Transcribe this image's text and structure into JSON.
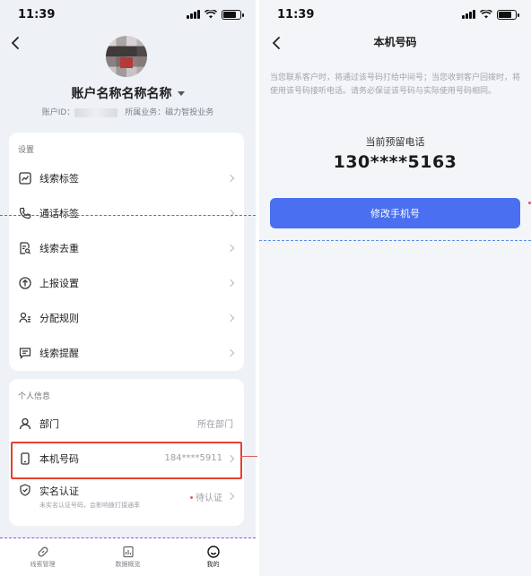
{
  "left": {
    "status": {
      "time": "11:39"
    },
    "account": {
      "name": "账户名称名称名称",
      "id_label": "账户ID：",
      "business_label": "所属业务：",
      "business_value": "磁力智投业务"
    },
    "settings": {
      "title": "设置",
      "items": [
        {
          "label": "线索标签",
          "icon": "tag-chart-icon"
        },
        {
          "label": "通话标签",
          "icon": "phone-icon"
        },
        {
          "label": "线索去重",
          "icon": "document-search-icon"
        },
        {
          "label": "上报设置",
          "icon": "upload-circle-icon"
        },
        {
          "label": "分配规则",
          "icon": "users-icon"
        },
        {
          "label": "线索提醒",
          "icon": "message-icon"
        }
      ]
    },
    "personal": {
      "title": "个人信息",
      "department": {
        "label": "部门",
        "value": "所在部门"
      },
      "phone": {
        "label": "本机号码",
        "value": "184****5911"
      },
      "realname": {
        "label": "实名认证",
        "sub": "未实名认证号码，会影响拨打接通率",
        "status": "待认证"
      }
    },
    "tabs": [
      {
        "label": "线索管理",
        "icon": "link-icon"
      },
      {
        "label": "数据概览",
        "icon": "chart-icon"
      },
      {
        "label": "我的",
        "icon": "smile-icon"
      }
    ]
  },
  "right": {
    "status": {
      "time": "11:39"
    },
    "title": "本机号码",
    "notice": "当您联系客户时，将通过该号码打给中间号；当您收到客户回拨时，将使用该号码接听电话。请务必保证该号码与实际使用号码相同。",
    "current_label": "当前预留电话",
    "current_number": "130****5163",
    "button_label": "修改手机号"
  },
  "colors": {
    "accent": "#4a6ff0",
    "highlight": "#e6402f",
    "pending_dot": "#e25b5b"
  }
}
